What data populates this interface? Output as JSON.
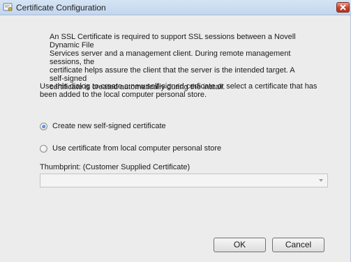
{
  "window": {
    "title": "Certificate Configuration",
    "app_icon": "certificate-icon",
    "close_icon": "close-icon"
  },
  "intro_text": "An  SSL Certificate is required to support SSL sessions between a Novell Dynamic File\nServices server and a  management client. During remote management sessions, the\ncertificate helps assure the client that the server is the intended target. A self-signed\ncertificate is created automatically during the install.",
  "instruction_text": "Use this dialog to create a new self-signed cerficate or select a certificate that has\nbeen added  to the local computer personal store.",
  "options": [
    {
      "label": "Create new self-signed certificate",
      "selected": true
    },
    {
      "label": "Use certificate from local computer personal store",
      "selected": false
    }
  ],
  "thumbprint": {
    "label": "Thumbprint: (Customer Supplied Certificate)",
    "value": "",
    "disabled": true
  },
  "buttons": {
    "ok": "OK",
    "cancel": "Cancel"
  }
}
